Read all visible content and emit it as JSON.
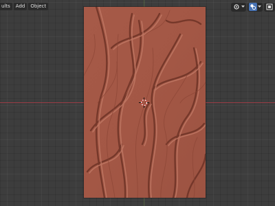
{
  "header": {
    "menus": [
      {
        "label": "ults"
      },
      {
        "label": "Add"
      },
      {
        "label": "Object"
      }
    ]
  },
  "viewport": {
    "object": "relief-plane",
    "relief_color": "#a55a48",
    "x_axis_color": "#9a3b45",
    "background_color": "#3d3d3d"
  },
  "header_tools": [
    {
      "icon": "gizmo-icon"
    },
    {
      "icon": "overlay-icon",
      "active": true
    },
    {
      "icon": "xray-icon"
    }
  ],
  "colors": {
    "accent": "#4772b3",
    "text": "#e2e2e2"
  }
}
